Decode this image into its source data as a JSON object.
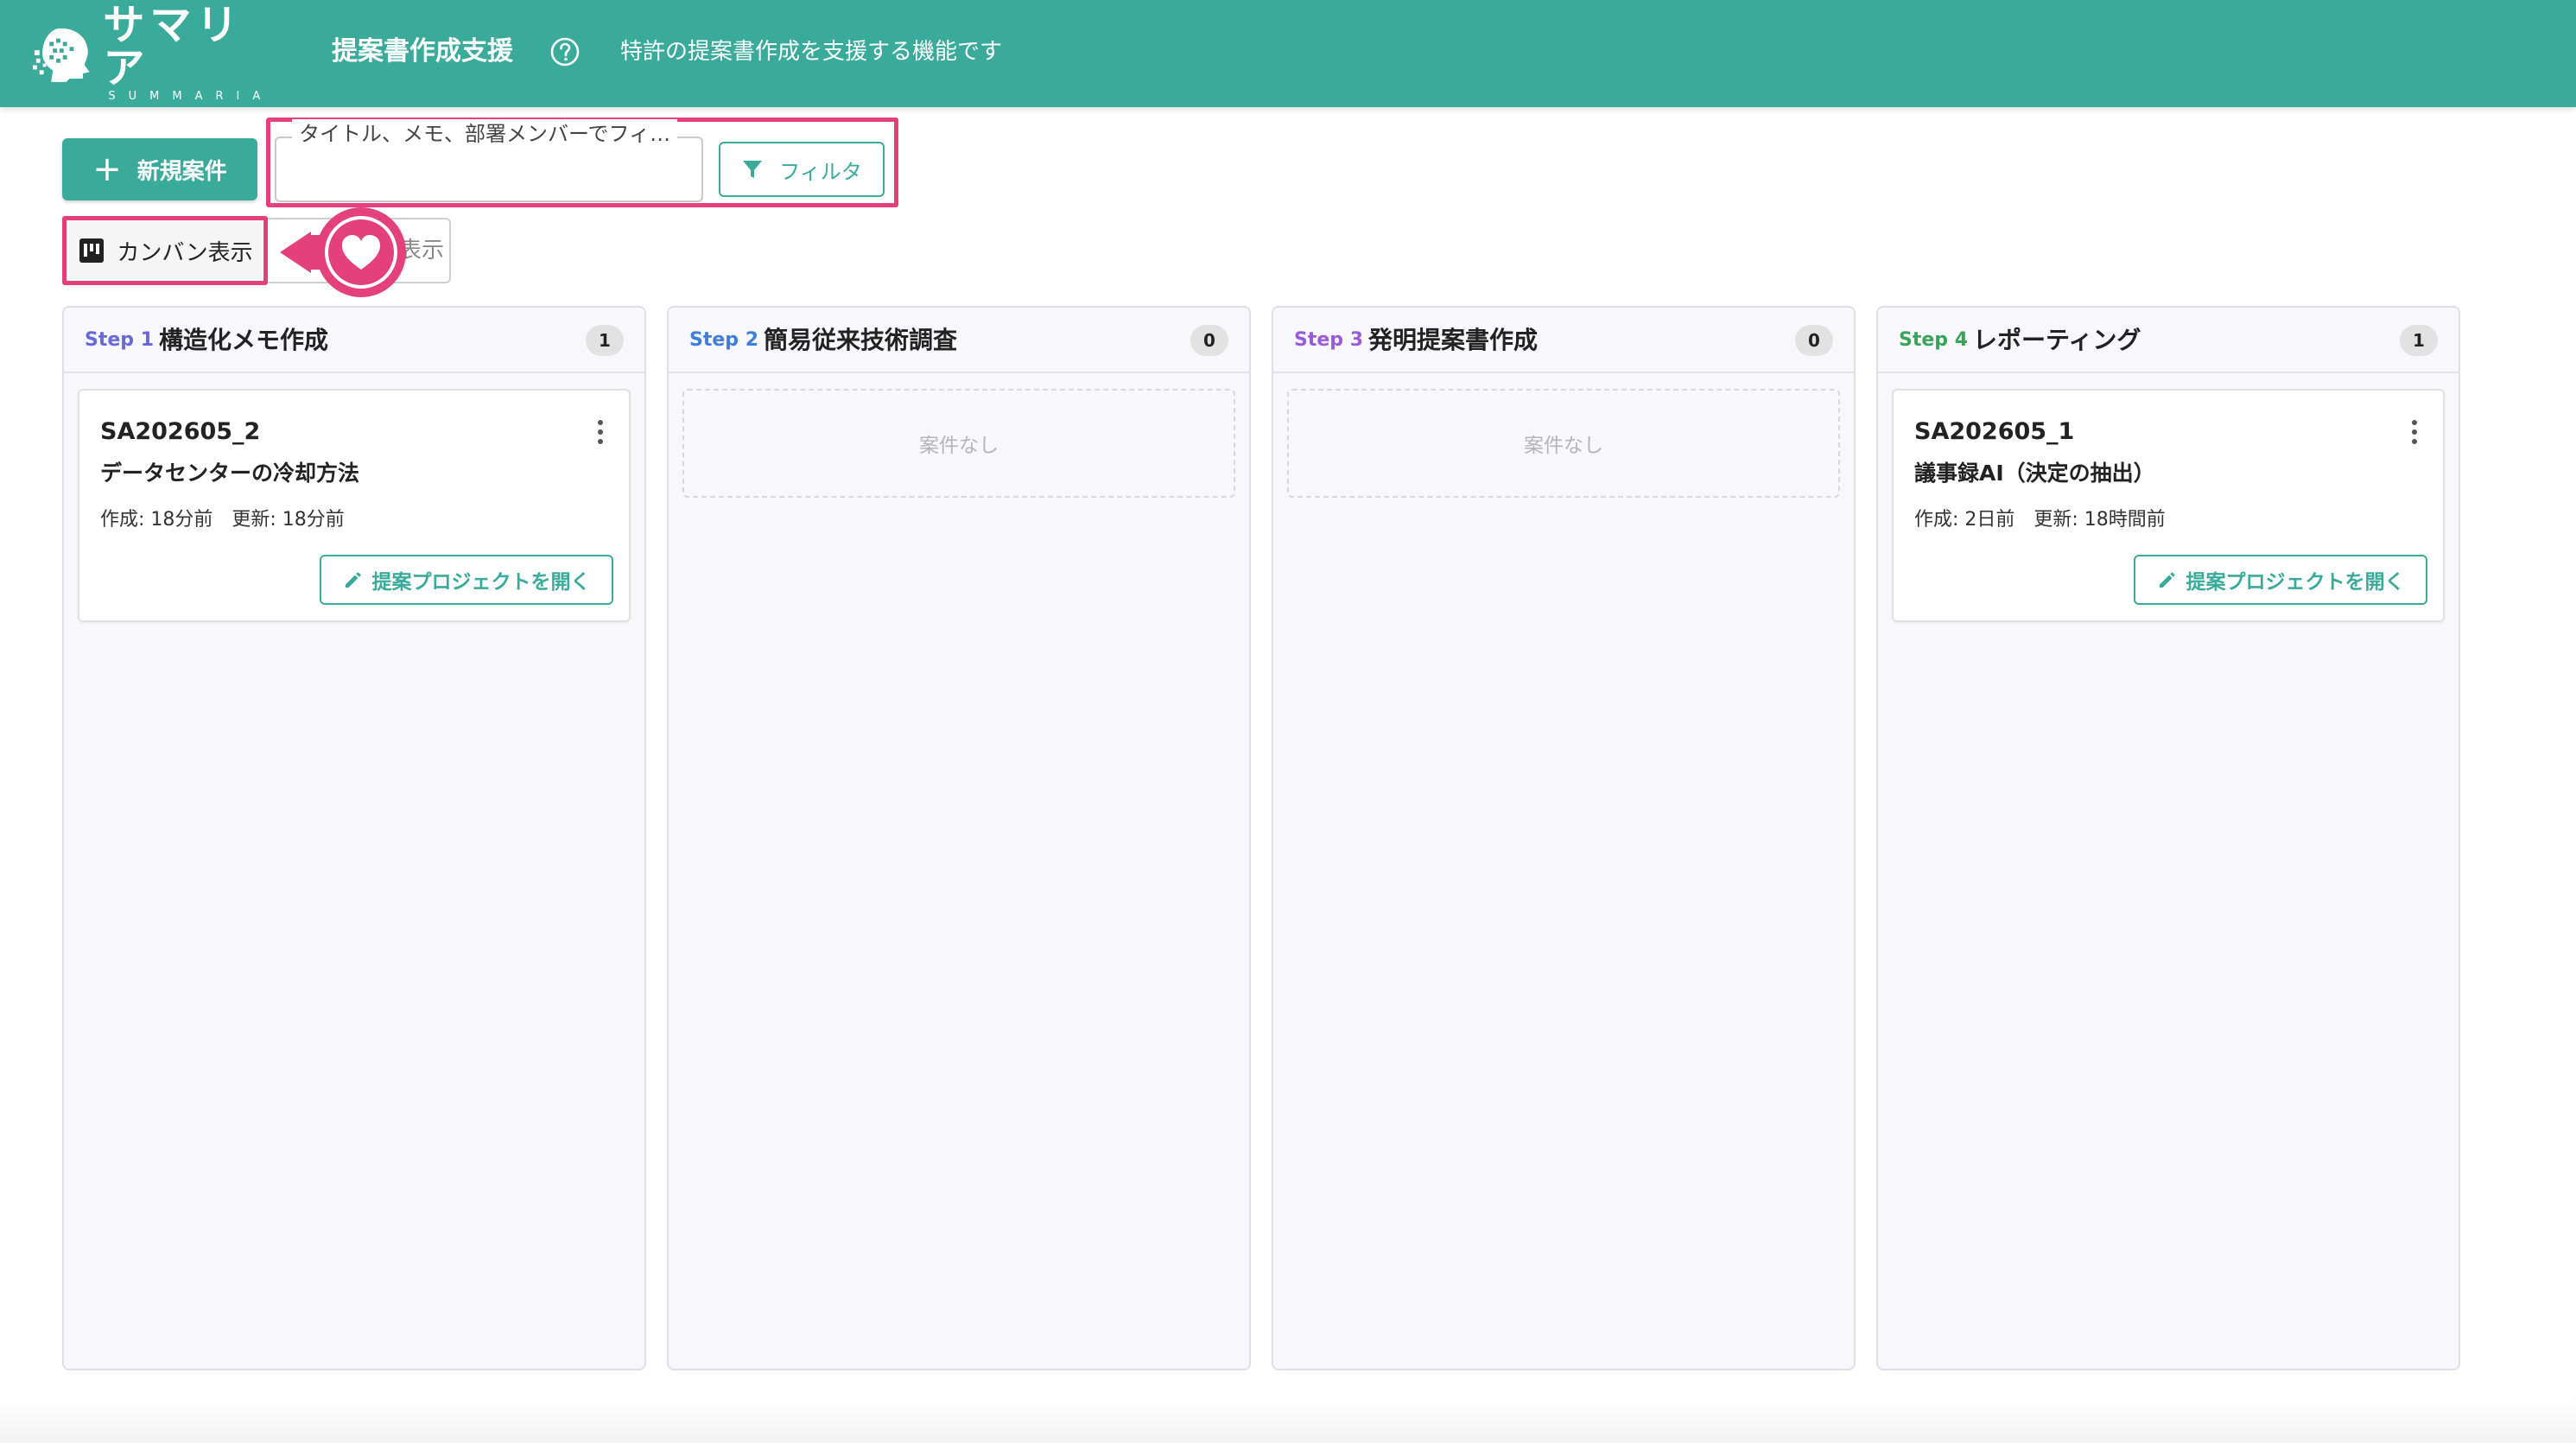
{
  "header": {
    "logo_jp": "サマリア",
    "logo_en": "SUMMARIA",
    "title": "提案書作成支援",
    "description": "特許の提案書作成を支援する機能です",
    "help_icon": "question-circle-icon"
  },
  "toolbar": {
    "new_case_label": "新規案件",
    "search_label": "タイトル、メモ、部署メンバーでフィ…",
    "search_value": "",
    "filter_label": "フィルタ",
    "view_kanban_label": "カンバン表示",
    "view_list_label_visible": "表示"
  },
  "colors": {
    "brand": "#3aab9b",
    "highlight": "#e3407c",
    "step1": "#6a68d8",
    "step2": "#3f7fd8",
    "step3": "#9a5bd8",
    "step4": "#3aa35a"
  },
  "columns": [
    {
      "step": "Step 1",
      "title": "構造化メモ作成",
      "count": "1",
      "cards": [
        {
          "id": "SA202605_2",
          "title": "データセンターの冷却方法",
          "meta": "作成: 18分前　更新: 18分前",
          "open_label": "提案プロジェクトを開く"
        }
      ]
    },
    {
      "step": "Step 2",
      "title": "簡易従来技術調査",
      "count": "0",
      "empty_label": "案件なし"
    },
    {
      "step": "Step 3",
      "title": "発明提案書作成",
      "count": "0",
      "empty_label": "案件なし"
    },
    {
      "step": "Step 4",
      "title": "レポーティング",
      "count": "1",
      "cards": [
        {
          "id": "SA202605_1",
          "title": "議事録AI（決定の抽出）",
          "meta": "作成: 2日前　更新: 18時間前",
          "open_label": "提案プロジェクトを開く"
        }
      ]
    }
  ]
}
